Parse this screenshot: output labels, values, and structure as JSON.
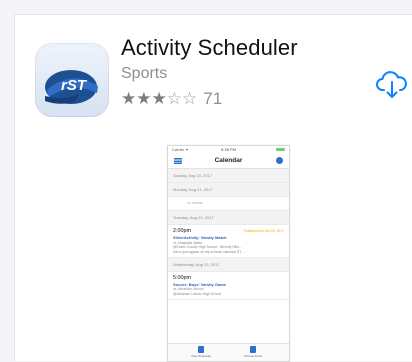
{
  "app": {
    "title": "Activity Scheduler",
    "category": "Sports",
    "rating_stars": 3,
    "rating_max": 5,
    "rating_count": "71",
    "icon_text": "rST",
    "accent_color": "#0a84ff"
  },
  "screenshot": {
    "status": {
      "carrier": "Carrier ✦",
      "time": "5:38 PM"
    },
    "nav_title": "Calendar",
    "days": [
      {
        "label": "Sunday, Aug 20, 2017"
      },
      {
        "label": "Monday, Aug 21, 2017"
      },
      {
        "empty": "no events"
      },
      {
        "label": "Tuesday, Aug 22, 2017"
      }
    ],
    "event1": {
      "time": "2:00pm",
      "tag": "Postponed to Oct 29, 2017",
      "title": "SilverActivity: Varsity Match",
      "lines": [
        "vs. Magnolia Jaden",
        "@Evann County High School - Beverly Hills...",
        "this is just appear on my schools calendar ST..."
      ]
    },
    "day2": "Wednesday, Aug 23, 2017",
    "event2": {
      "time": "5:00pm",
      "title": "Soccer: Boys' Varsity Game",
      "lines": [
        "vs. Abraham Lincoln",
        "@Abraham Lincoln High School"
      ]
    },
    "tabs": [
      "View Schedule",
      "Choose Team"
    ]
  }
}
